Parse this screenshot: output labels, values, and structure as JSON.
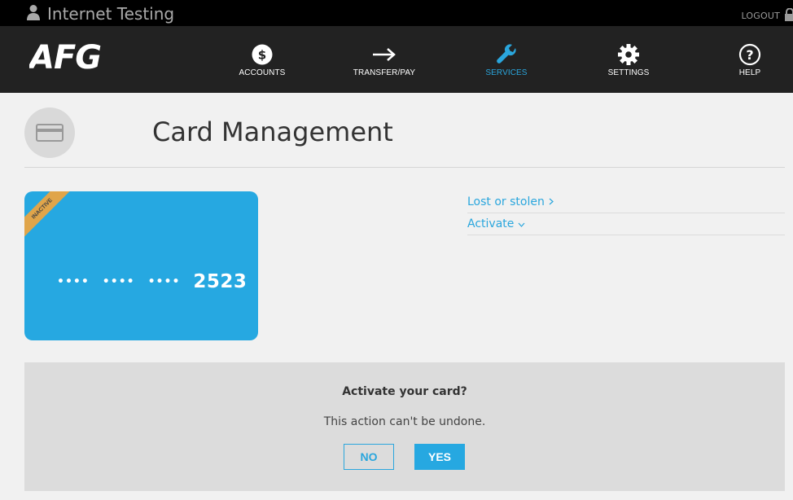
{
  "topbar": {
    "user_name": "Internet Testing",
    "logout_label": "LOGOUT"
  },
  "brand": {
    "logo_text": "AFG"
  },
  "nav": {
    "items": [
      {
        "label": "ACCOUNTS",
        "icon": "dollar-circle-icon"
      },
      {
        "label": "TRANSFER/PAY",
        "icon": "arrow-right-icon"
      },
      {
        "label": "SERVICES",
        "icon": "wrench-icon",
        "active": true
      },
      {
        "label": "SETTINGS",
        "icon": "gear-icon"
      },
      {
        "label": "HELP",
        "icon": "question-circle-icon"
      }
    ]
  },
  "page": {
    "title": "Card Management"
  },
  "card": {
    "status_ribbon": "INACTIVE",
    "masked_groups": "•••• •••• ••••",
    "group1": "••••",
    "group2": "••••",
    "group3": "••••",
    "last4": "2523"
  },
  "actions": {
    "lost_or_stolen": "Lost or stolen",
    "activate": "Activate"
  },
  "confirm": {
    "question": "Activate your card?",
    "warning": "This action can't be undone.",
    "no_label": "NO",
    "yes_label": "YES"
  },
  "colors": {
    "accent": "#26a8e1",
    "nav_bg": "#222222",
    "ribbon": "#e0a54a"
  }
}
